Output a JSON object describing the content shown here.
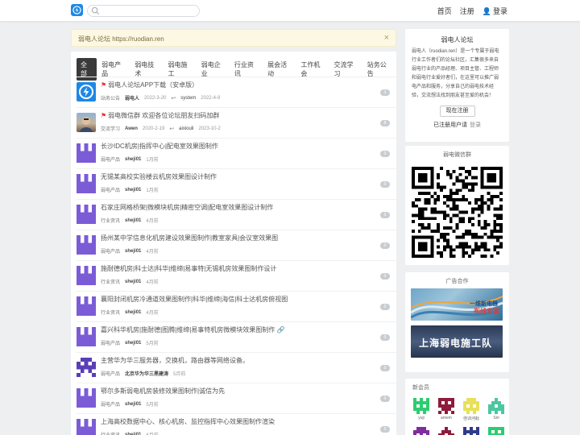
{
  "header": {
    "nav": {
      "home": "首页",
      "register": "注册",
      "login": "登录"
    }
  },
  "notice": {
    "text": "弱电人论坛 https://ruodian.ren",
    "close": "×"
  },
  "tabs": [
    "全部",
    "弱电产品",
    "弱电技术",
    "弱电施工",
    "弱电企业",
    "行业资讯",
    "展会活动",
    "工作机会",
    "交流学习",
    "站务公告"
  ],
  "threads": [
    {
      "title": "弱电人论坛APP下载（安卓版）",
      "pinned": true,
      "category": "站务公告",
      "author": "弱电人",
      "date": "2022-3-20",
      "reply_user": "system",
      "reply_date": "2022-4-9",
      "count": "3",
      "avatar": "app"
    },
    {
      "title": "弱电微信群 欢迎各位论坛朋友扫码加群",
      "pinned": true,
      "category": "交流学习",
      "author": "Awen",
      "date": "2020-2-19",
      "reply_user": "aixiouli",
      "reply_date": "2023-10-2",
      "count": "8",
      "avatar": "photo"
    },
    {
      "title": "长沙IDC机房|指挥中心|配电室效果图制作",
      "pinned": false,
      "category": "弱电产品",
      "author": "sheji01",
      "date": "1月前",
      "reply_user": "",
      "reply_date": "",
      "count": "0",
      "avatar": "purple"
    },
    {
      "title": "无锡某高校实验楼云机房效果图设计制作",
      "pinned": false,
      "category": "弱电产品",
      "author": "sheji01",
      "date": "1月前",
      "reply_user": "",
      "reply_date": "",
      "count": "0",
      "avatar": "purple"
    },
    {
      "title": "石家庄网格桥架|微模块机房|精密空调|配电室效果图设计制作",
      "pinned": false,
      "category": "行业资讯",
      "author": "sheji01",
      "date": "4月前",
      "reply_user": "",
      "reply_date": "",
      "count": "0",
      "avatar": "purple"
    },
    {
      "title": "扬州某中学信息化机房建设效果图制作|教室家具|会议室效果图",
      "pinned": false,
      "category": "弱电产品",
      "author": "sheji01",
      "date": "4月前",
      "reply_user": "",
      "reply_date": "",
      "count": "0",
      "avatar": "purple"
    },
    {
      "title": "施耐德机房|科士达|科华|维缔|易事特|无锡机房效果图制作设计",
      "pinned": false,
      "category": "行业资讯",
      "author": "sheji01",
      "date": "4月前",
      "reply_user": "",
      "reply_date": "",
      "count": "0",
      "avatar": "purple"
    },
    {
      "title": "襄阳封闭机房冷通道效果图制作|科华|维缔|海信|科士达机房俯视图",
      "pinned": false,
      "category": "行业资讯",
      "author": "sheji01",
      "date": "4月前",
      "reply_user": "",
      "reply_date": "",
      "count": "0",
      "avatar": "purple"
    },
    {
      "title": "嘉兴科华机房|施耐德|图腾|维缔|易事特机房微模块效果图制作",
      "pinned": false,
      "category": "弱电产品",
      "author": "sheji01",
      "date": "5月前",
      "reply_user": "",
      "reply_date": "",
      "count": "0",
      "avatar": "purple",
      "attach": true
    },
    {
      "title": "主营华为华三服务器，交换机，路由器等网络设备。",
      "pinned": false,
      "category": "弱电产品",
      "author": "北京华为华三黑建涛",
      "date": "5月前",
      "reply_user": "",
      "reply_date": "",
      "count": "0",
      "avatar": "invader"
    },
    {
      "title": "鄂尔多斯弱电机房装修效果图制作|诚信为先",
      "pinned": false,
      "category": "弱电产品",
      "author": "sheji01",
      "date": "5月前",
      "reply_user": "",
      "reply_date": "",
      "count": "0",
      "avatar": "purple"
    },
    {
      "title": "上海高校数据中心、核心机房、监控指挥中心效果图制作渲染",
      "pinned": false,
      "category": "行业资讯",
      "author": "sheji01",
      "date": "6月前",
      "reply_user": "",
      "reply_date": "",
      "count": "0",
      "avatar": "purple"
    }
  ],
  "sidebar": {
    "forum_title": "弱电人论坛",
    "intro": "弱电人（ruodian.ren）是一个专属于弱电行业工作者们的论坛社区，汇集很多来自弱电行业的产品经理、项目主管、工程师和弱电行业爱好者们，在这里可以推广弱电产品和服务，分享自己的弱电技术经验，交流想法找到朋友甚至爱的机会！",
    "register_button": "现在注册",
    "registered_text": "已注册用户请",
    "login_link": "登录",
    "wechat_title": "弱电微信群",
    "ads_title": "广告合作",
    "ad1_line1": "一维新电器",
    "ad1_line2": "布线专家",
    "ad2_text": "上海弱电施工队",
    "members_title": "新会员",
    "members": [
      {
        "name": "yuji",
        "color": "#2ecc71"
      },
      {
        "name": "amem",
        "color": "#8e1c3a"
      },
      {
        "name": "佳训河耘",
        "color": "#e8e05a"
      },
      {
        "name": "Siri",
        "color": "#4cc7a0"
      }
    ],
    "members_row2_colors": [
      "#7d2d9e",
      "#8e1c3a",
      "#2f3b8a",
      "#2ecc71"
    ]
  },
  "colors": {
    "accent": "#1e88e5",
    "pin_flag": "#e53935",
    "tab_active": "#3a3a3a",
    "avatar_purple": "#7b5cd6"
  }
}
